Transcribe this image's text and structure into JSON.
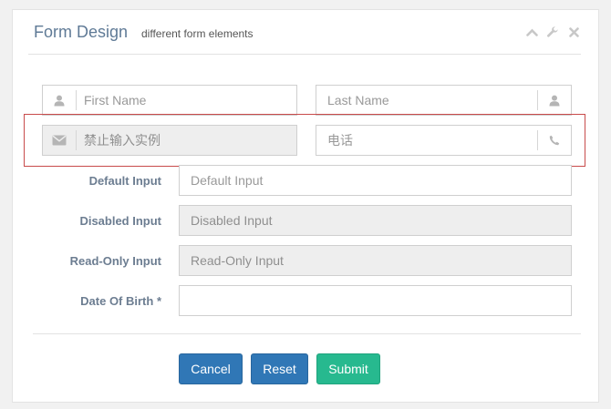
{
  "panel": {
    "title": "Form Design",
    "subtitle": "different form elements",
    "tools": [
      "chevron-up-icon",
      "wrench-icon",
      "close-icon"
    ]
  },
  "form": {
    "first_name": {
      "placeholder": "First Name",
      "icon": "user-icon"
    },
    "last_name": {
      "placeholder": "Last Name",
      "icon": "user-icon"
    },
    "email": {
      "placeholder": "禁止输入实例",
      "icon": "envelope-icon",
      "disabled": true
    },
    "phone": {
      "placeholder": "电话",
      "icon": "phone-icon"
    },
    "rows": {
      "default": {
        "label": "Default Input",
        "placeholder": "Default Input"
      },
      "disabled": {
        "label": "Disabled Input",
        "placeholder": "Disabled Input"
      },
      "readonly": {
        "label": "Read-Only Input",
        "placeholder": "Read-Only Input"
      },
      "dob": {
        "label": "Date Of Birth *",
        "placeholder": ""
      }
    }
  },
  "buttons": {
    "cancel": "Cancel",
    "reset": "Reset",
    "submit": "Submit"
  },
  "colors": {
    "primary": "#3077b6",
    "success": "#27b98f",
    "highlight": "#c84b4b",
    "title": "#5f7a96"
  }
}
